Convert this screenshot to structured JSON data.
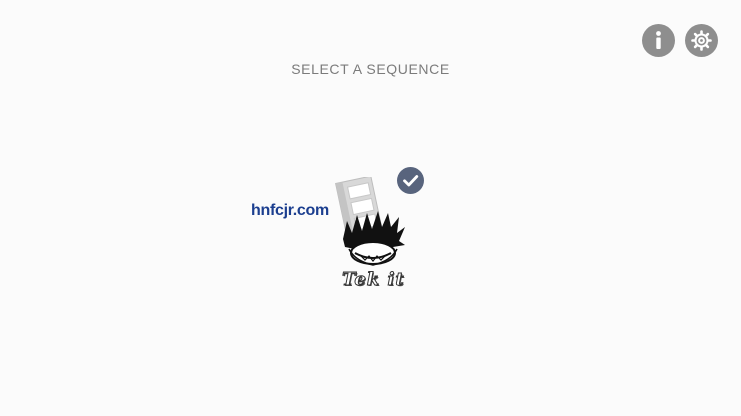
{
  "header": {
    "title": "SELECT A SEQUENCE",
    "info_button_icon": "info-icon",
    "settings_button_icon": "gear-icon"
  },
  "sequences": [
    {
      "label": "Tek it",
      "selected": true,
      "watermark": "hnfcjr.com",
      "art_icon": "film-strip-character-logo"
    }
  ],
  "colors": {
    "background": "#fbfbfb",
    "round_button": "#8e8e8e",
    "selected_badge": "#58647d",
    "title_text": "#7b7b7b",
    "watermark_text": "#1b3e8f"
  }
}
